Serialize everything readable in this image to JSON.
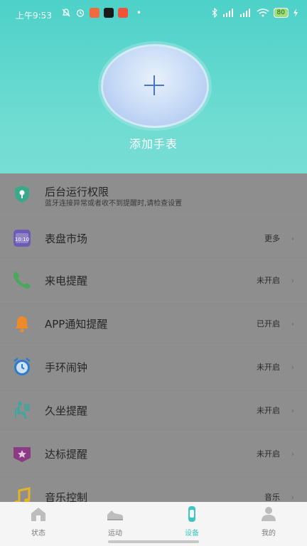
{
  "status_bar": {
    "time": "上午9:53",
    "dot": "•",
    "battery": "80",
    "charging_icon": "lightning-icon"
  },
  "header": {
    "add_watch_label": "添加手表"
  },
  "settings": [
    {
      "id": "background",
      "title": "后台运行权限",
      "subtitle": "蓝牙连接异常或者收不到提醒时,请检查设置",
      "value": "",
      "icon": "shield-location-icon",
      "color": "#3aa98b"
    },
    {
      "id": "watchface",
      "title": "表盘市场",
      "subtitle": "",
      "value": "更多",
      "icon": "watch-face-icon",
      "color": "#6d5bb6"
    },
    {
      "id": "call",
      "title": "来电提醒",
      "subtitle": "",
      "value": "未开启",
      "icon": "phone-icon",
      "color": "#4aa85b"
    },
    {
      "id": "app_notify",
      "title": "APP通知提醒",
      "subtitle": "",
      "value": "已开启",
      "icon": "bell-icon",
      "color": "#ef8a2a"
    },
    {
      "id": "alarm",
      "title": "手环闹钟",
      "subtitle": "",
      "value": "未开启",
      "icon": "alarm-clock-icon",
      "color": "#2a7bd1"
    },
    {
      "id": "sedentary",
      "title": "久坐提醒",
      "subtitle": "",
      "value": "未开启",
      "icon": "sitting-person-icon",
      "color": "#38a8a0"
    },
    {
      "id": "goal",
      "title": "达标提醒",
      "subtitle": "",
      "value": "未开启",
      "icon": "badge-star-icon",
      "color": "#8b3a84"
    },
    {
      "id": "music",
      "title": "音乐控制",
      "subtitle": "",
      "value": "音乐",
      "icon": "music-note-icon",
      "color": "#e6b422"
    }
  ],
  "tabbar": {
    "tabs": [
      {
        "label": "状态",
        "icon": "home-icon"
      },
      {
        "label": "运动",
        "icon": "shoe-icon"
      },
      {
        "label": "设备",
        "icon": "watch-icon"
      },
      {
        "label": "我的",
        "icon": "person-icon"
      }
    ],
    "active_index": 2,
    "active_color": "#3ec7c0"
  }
}
